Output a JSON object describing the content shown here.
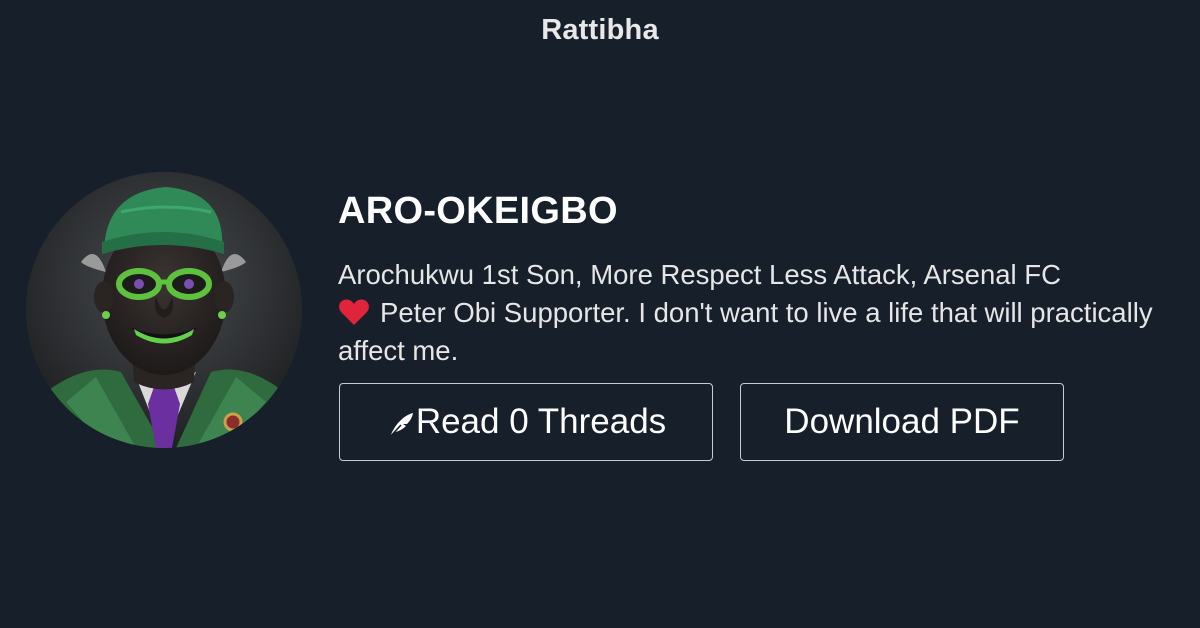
{
  "site": {
    "title": "Rattibha"
  },
  "profile": {
    "name": "ARO-OKEIGBO",
    "bio_part1": "Arochukwu 1st Son, More Respect Less Attack, Arsenal FC",
    "bio_part2": "Peter Obi Supporter. I don't want to live a life that will practically affect me.",
    "avatar_icon": "profile-avatar"
  },
  "actions": {
    "read_label": "Read 0 Threads",
    "read_icon": "feather-icon",
    "download_label": "Download PDF"
  },
  "colors": {
    "background": "#161f2a",
    "text": "#ffffff",
    "button_border": "#c9ccd1",
    "heart": "#e0243c"
  }
}
